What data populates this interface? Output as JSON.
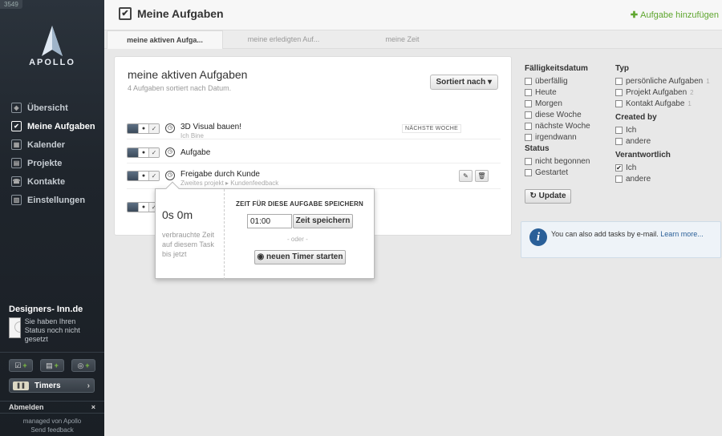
{
  "sidebar": {
    "badge": "3549",
    "logo_text": "APOLLO",
    "nav": [
      {
        "label": "Übersicht",
        "icon": "dashboard-icon"
      },
      {
        "label": "Meine Aufgaben",
        "icon": "checkbox-icon"
      },
      {
        "label": "Kalender",
        "icon": "calendar-icon"
      },
      {
        "label": "Projekte",
        "icon": "projects-icon"
      },
      {
        "label": "Kontakte",
        "icon": "contacts-icon"
      },
      {
        "label": "Einstellungen",
        "icon": "settings-icon"
      }
    ],
    "user_name": "Designers- Inn.de",
    "user_status": "Sie haben Ihren Status noch nicht gesetzt",
    "timers_label": "Timers",
    "logout_label": "Abmelden",
    "logout_close": "×",
    "footer_line1": "managed von Apollo",
    "footer_line2": "Send feedback"
  },
  "header": {
    "title": "Meine Aufgaben",
    "add_task": "Aufgabe hinzufügen"
  },
  "tabs": [
    {
      "label": "meine aktiven Aufga..."
    },
    {
      "label": "meine erledigten Auf..."
    },
    {
      "label": "meine Zeit"
    }
  ],
  "card": {
    "title": "meine aktiven Aufgaben",
    "subtitle": "4 Aufgaben sortiert nach Datum.",
    "sort_button": "Sortiert nach ▾"
  },
  "tasks": [
    {
      "title": "3D Visual bauen!",
      "sub": "Ich Bine",
      "due": "NÄCHSTE WOCHE"
    },
    {
      "title": "Aufgabe",
      "sub": "",
      "due": ""
    },
    {
      "title": "Freigabe durch Kunde",
      "sub": "Zweites projekt ▸ Kundenfeedback",
      "due": ""
    }
  ],
  "popup": {
    "time_value": "0s 0m",
    "time_desc": "verbrauchte Zeit auf diesem Task bis jetzt",
    "heading": "ZEIT FÜR DIESE AUFGABE SPEICHERN",
    "time_input": "01:00",
    "save_button": "Zeit speichern",
    "or_text": "- oder -",
    "timer_button": "neuen Timer starten"
  },
  "filters": {
    "due_heading": "Fälligkeitsdatum",
    "due_items": [
      {
        "label": "überfällig",
        "checked": false
      },
      {
        "label": "Heute",
        "checked": false
      },
      {
        "label": "Morgen",
        "checked": false
      },
      {
        "label": "diese Woche",
        "checked": false
      },
      {
        "label": "nächste Woche",
        "checked": false
      },
      {
        "label": "irgendwann",
        "checked": false
      }
    ],
    "status_heading": "Status",
    "status_items": [
      {
        "label": "nicht begonnen",
        "checked": false
      },
      {
        "label": "Gestartet",
        "checked": false
      }
    ],
    "type_heading": "Typ",
    "type_items": [
      {
        "label": "persönliche Aufgaben",
        "count": "1",
        "checked": false
      },
      {
        "label": "Projekt Aufgaben",
        "count": "2",
        "checked": false
      },
      {
        "label": "Kontakt Aufgabe",
        "count": "1",
        "checked": false
      }
    ],
    "created_heading": "Created by",
    "created_items": [
      {
        "label": "Ich",
        "checked": false
      },
      {
        "label": "andere",
        "checked": false
      }
    ],
    "resp_heading": "Verantwortlich",
    "resp_items": [
      {
        "label": "Ich",
        "checked": true
      },
      {
        "label": "andere",
        "checked": false
      }
    ],
    "update_button": "Update"
  },
  "info": {
    "text": "You can also add tasks by e-mail.",
    "link": "Learn more..."
  },
  "colors": {
    "accent_green": "#5fa62f",
    "link_blue": "#2a5f98",
    "sidebar_bg": "#1f252c"
  }
}
